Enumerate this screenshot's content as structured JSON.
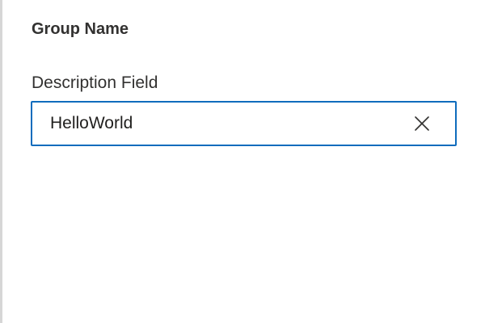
{
  "panel": {
    "group_title": "Group Name",
    "field": {
      "label": "Description Field",
      "value": "HelloWorld",
      "clear_icon": "close-icon"
    }
  },
  "colors": {
    "focus_border": "#0f6cbd",
    "text": "#323130"
  }
}
